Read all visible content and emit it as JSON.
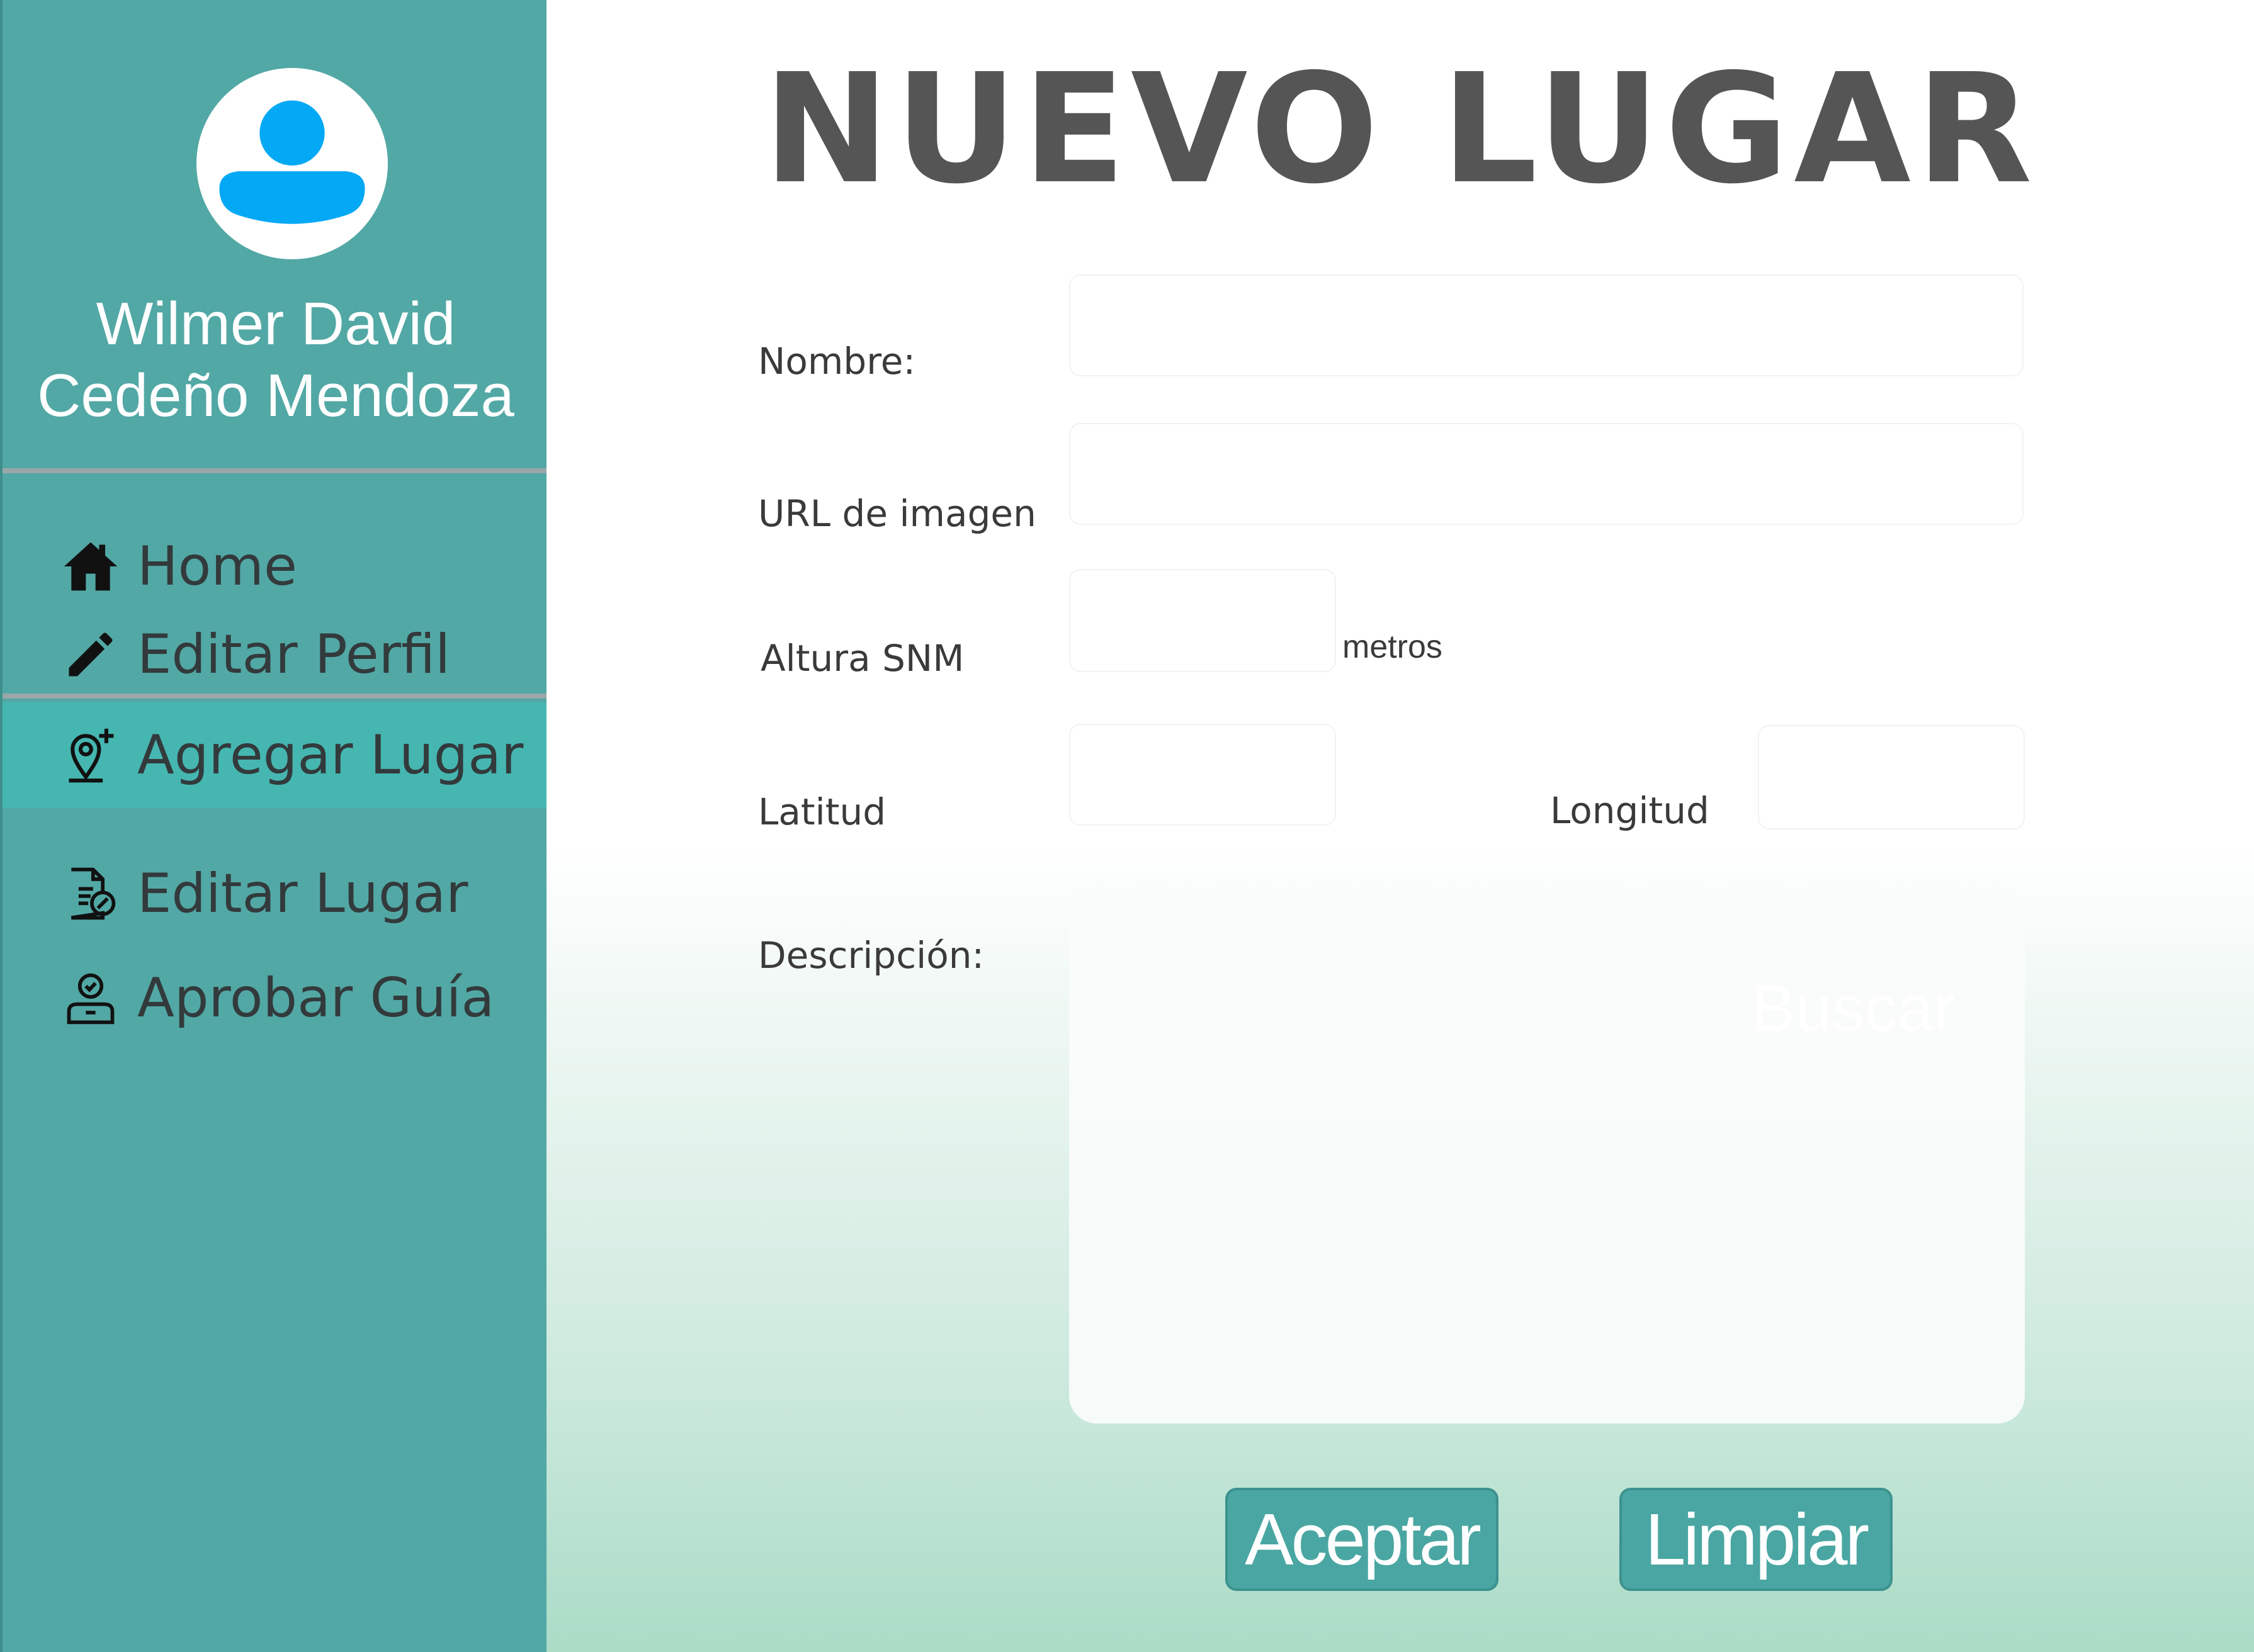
{
  "user": {
    "name_line1": "Wilmer David",
    "name_line2": "Cedeño Mendoza"
  },
  "nav": {
    "home": "Home",
    "edit_profile": "Editar Perfil",
    "add_place": "Agregar Lugar",
    "edit_place": "Editar Lugar",
    "approve_guide": "Aprobar Guía",
    "active": "Agregar Lugar"
  },
  "page": {
    "title": "NUEVO LUGAR"
  },
  "form": {
    "name_label": "Nombre:",
    "name_value": "",
    "image_url_label": "URL de imagen",
    "image_url_value": "",
    "altitude_label": "Altura SNM",
    "altitude_value": "",
    "altitude_unit": "metros",
    "latitude_label": "Latitud",
    "latitude_value": "",
    "longitude_label": "Longitud",
    "longitude_value": "",
    "description_label": "Descripción:",
    "description_value": "",
    "ghost_text": "Buscar"
  },
  "buttons": {
    "accept": "Aceptar",
    "clear": "Limpiar"
  },
  "colors": {
    "sidebar": "#52a8a5",
    "sidebar_active": "#46b6b1",
    "avatar_icon": "#03a9f4",
    "button": "#4aa6a2",
    "title": "#555555"
  }
}
